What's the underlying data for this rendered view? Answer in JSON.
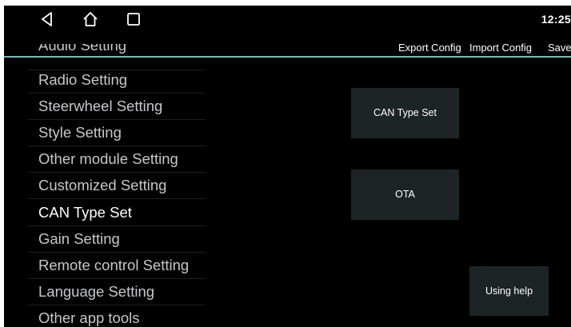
{
  "status_bar": {
    "time": "12:25",
    "nav_buttons": [
      {
        "name": "back",
        "icon": "triangle-back-icon"
      },
      {
        "name": "home",
        "icon": "home-outline-icon"
      },
      {
        "name": "recents",
        "icon": "square-recents-icon"
      }
    ]
  },
  "toolbar": {
    "export_label": "Export Config",
    "import_label": "Import Config",
    "save_label": "Save"
  },
  "menu": {
    "partial_top_label": "Audio Setting",
    "items": [
      {
        "label": "Radio Setting"
      },
      {
        "label": "Steerwheel Setting"
      },
      {
        "label": "Style Setting"
      },
      {
        "label": "Other module Setting"
      },
      {
        "label": "Customized Setting"
      },
      {
        "label": "CAN Type Set",
        "selected": true
      },
      {
        "label": "Gain Setting"
      },
      {
        "label": "Remote control Setting"
      },
      {
        "label": "Language Setting"
      },
      {
        "label": "Other app tools"
      }
    ]
  },
  "panel": {
    "can_type_button": "CAN Type Set",
    "ota_button": "OTA",
    "help_button": "Using help"
  },
  "colors": {
    "background": "#000000",
    "divider_accent": "#7fb7b5",
    "button_bg": "#1d2426",
    "menu_text": "#c5c8c9",
    "menu_selected_text": "#ffffff"
  }
}
